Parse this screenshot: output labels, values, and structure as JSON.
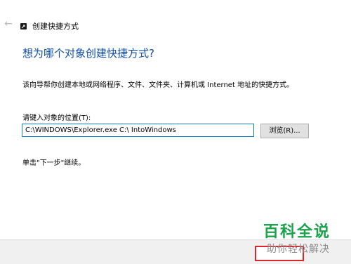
{
  "window": {
    "back_icon": "back-arrow-icon",
    "title_icon": "shortcut-icon",
    "title": "创建快捷方式"
  },
  "content": {
    "heading": "想为哪个对象创建快捷方式?",
    "description": "该向导帮你创建本地或网络程序、文件、文件夹、计算机或 Internet 地址的快捷方式。",
    "location_label": "请键入对象的位置(T):",
    "location_value": "C:\\WINDOWS\\Explorer.exe C:\\ IntoWindows",
    "browse_label": "浏览(R)...",
    "next_hint": "单击\"下一步\"继续。"
  },
  "watermark": {
    "line1": "百科全说",
    "line2": "助你轻松解决"
  },
  "colors": {
    "heading": "#0f4fa8",
    "input_border": "#0e7ad0",
    "highlight_box": "#d9262b",
    "watermark_green": "#1aa34a"
  }
}
